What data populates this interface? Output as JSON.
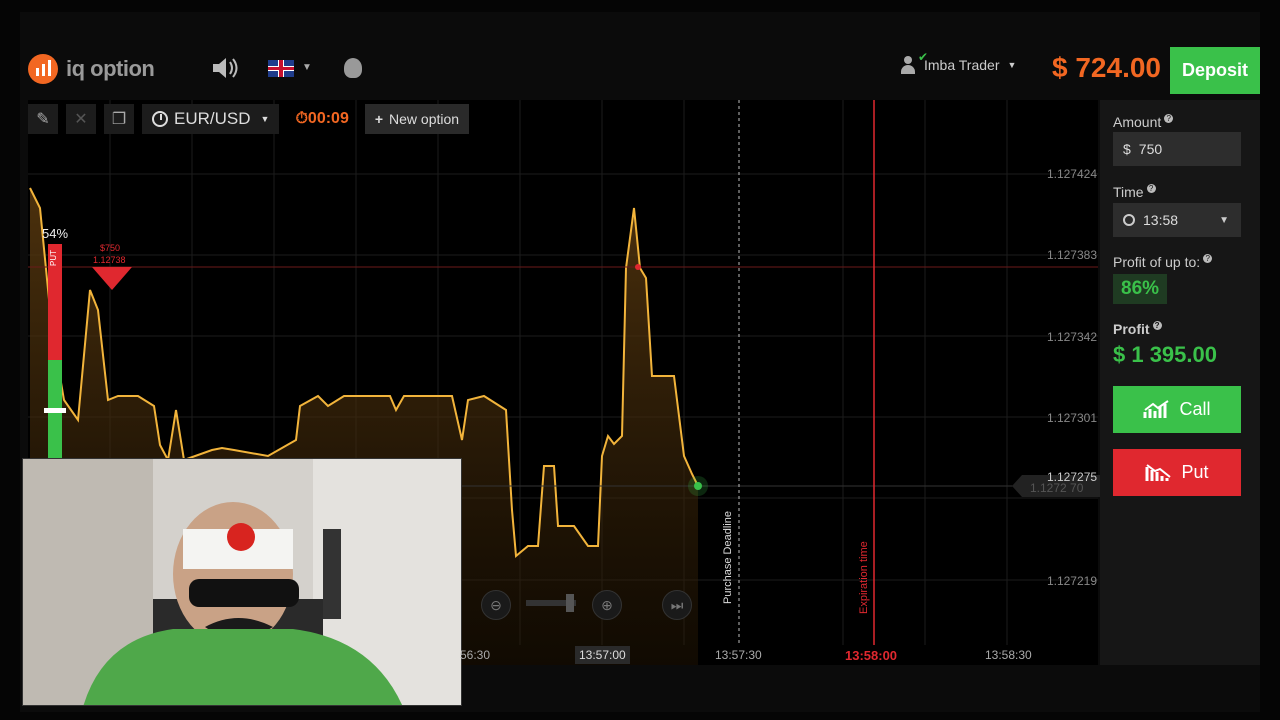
{
  "brand": {
    "logo_text": "iq option",
    "accent": "#f26722"
  },
  "header": {
    "user_name": "Imba Trader",
    "balance": "$ 724.00",
    "deposit_label": "Deposit"
  },
  "toolbar": {
    "asset": "EUR/USD",
    "timer": "00:09",
    "new_option_label": "New option"
  },
  "chart": {
    "put_percent": "54%",
    "put_bar_label": "PUT",
    "put_share": 0.54,
    "deal_amount": "$750",
    "deal_price": "1.12738",
    "y_ticks": [
      "1.127424",
      "1.127383",
      "1.127342",
      "1.127301",
      "1.127275",
      "1.127219"
    ],
    "current_price": "1.127275",
    "current_price_ghost": "1.1272 70",
    "purchase_deadline_label": "Purchase Deadline",
    "expiration_label": "Expiration time",
    "x_ticks": [
      "56:30",
      "13:57:00",
      "13:57:30",
      "13:58:00",
      "13:58:30"
    ],
    "colors": {
      "line": "#f2b43b",
      "put": "#e0282f",
      "call": "#3ac14a"
    }
  },
  "panel": {
    "amount_label": "Amount",
    "amount_currency": "$",
    "amount_value": "750",
    "time_label": "Time",
    "time_value": "13:58",
    "profit_upto_label": "Profit of up to:",
    "profit_upto_value": "86%",
    "profit_label": "Profit",
    "profit_value": "$ 1 395.00",
    "call_label": "Call",
    "put_label": "Put"
  }
}
